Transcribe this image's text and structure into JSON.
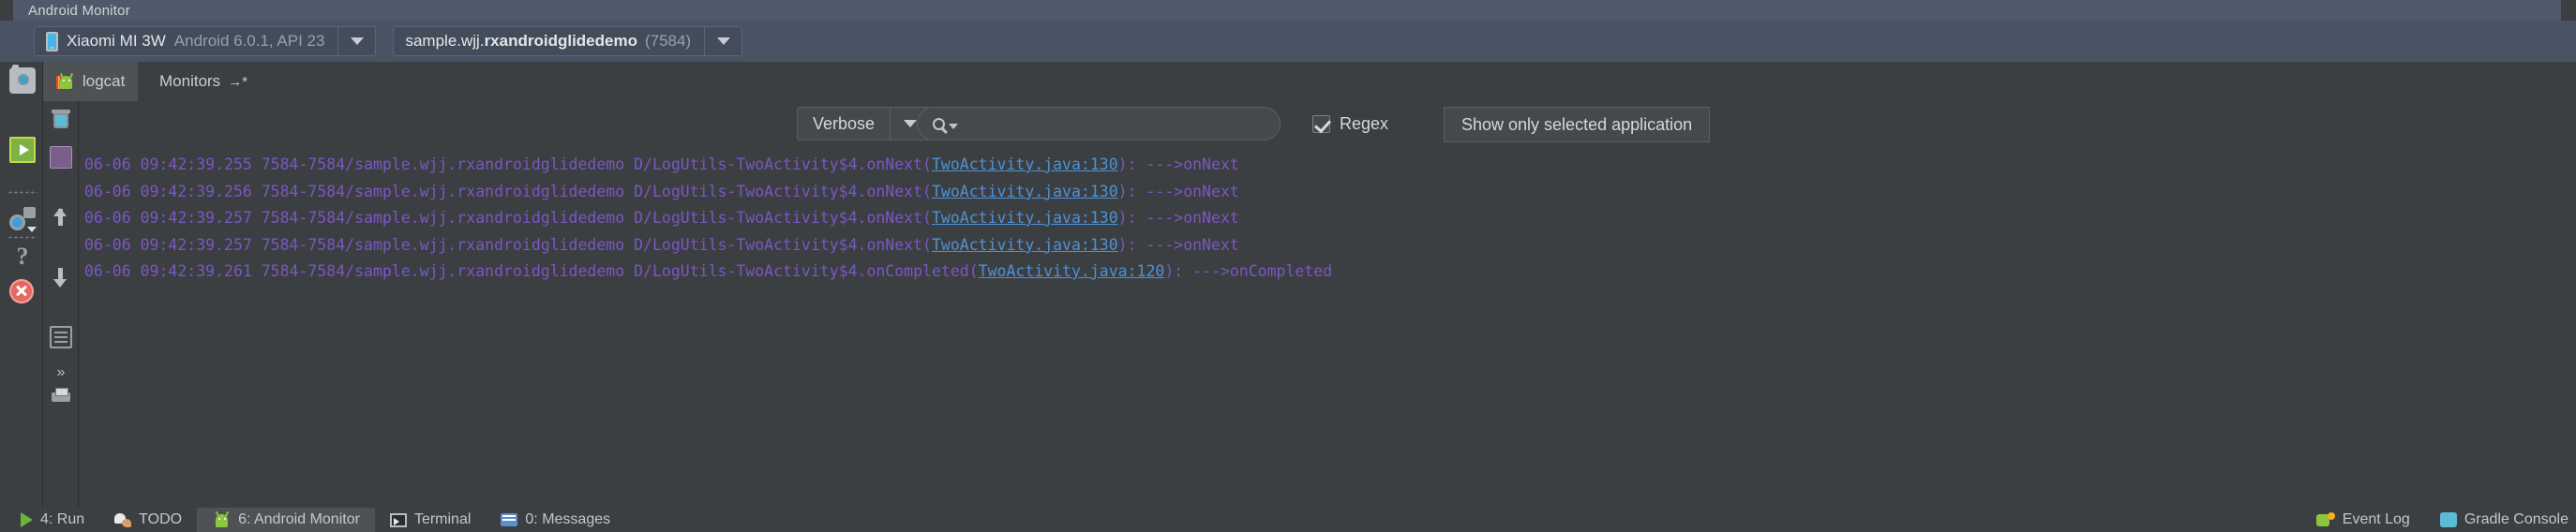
{
  "window": {
    "title": "Android Monitor"
  },
  "toolbar": {
    "device": {
      "icon": "phone-icon",
      "name": "Xiaomi MI 3W",
      "details": "Android 6.0.1, API 23",
      "dropdown_icon": "chevron-down-icon"
    },
    "process": {
      "package_prefix": "sample.wjj.",
      "package_name": "rxandroidglidedemo",
      "pid": "(7584)",
      "dropdown_icon": "chevron-down-icon"
    }
  },
  "left_toolstrip": {
    "icons": [
      {
        "name": "screenshot-camera-icon",
        "title": "Screen Capture"
      },
      {
        "name": "screen-record-play-icon",
        "title": "Screen Record"
      },
      {
        "name": "layout-inspector-icon",
        "title": "Layout Inspector"
      },
      {
        "name": "terminate-application-icon",
        "title": "Terminate Application"
      },
      {
        "name": "help-question-icon",
        "title": "Help"
      }
    ]
  },
  "tabs": [
    {
      "label": "logcat",
      "icon": "logcat-android-icon",
      "selected": true
    },
    {
      "label": "Monitors",
      "suffix": "→*",
      "icon": "monitors-icon",
      "selected": false
    }
  ],
  "logcat_tools": {
    "icons": [
      {
        "name": "clear-logcat-trash-icon"
      },
      {
        "name": "scroll-to-end-icon"
      },
      {
        "name": "up-arrow-icon"
      },
      {
        "name": "down-arrow-icon"
      },
      {
        "name": "soft-wrap-icon"
      },
      {
        "name": "print-icon"
      },
      {
        "name": "expand-more-icon",
        "glyph": "»"
      }
    ]
  },
  "filter_bar": {
    "log_level": {
      "value": "Verbose",
      "dropdown_icon": "chevron-down-icon"
    },
    "search": {
      "value": "",
      "placeholder": "",
      "icon": "search-icon"
    },
    "regex": {
      "label": "Regex",
      "checked": true
    },
    "app_filter": {
      "value": "Show only selected application",
      "dropdown_icon": "chevron-down-icon"
    }
  },
  "log_lines": [
    {
      "pre": "06-06 09:42:39.255 7584-7584/sample.wjj.rxandroidglidedemo D/LogUtils-TwoActivity$4.onNext(",
      "link": "TwoActivity.java:130",
      "post": "): --->onNext"
    },
    {
      "pre": "06-06 09:42:39.256 7584-7584/sample.wjj.rxandroidglidedemo D/LogUtils-TwoActivity$4.onNext(",
      "link": "TwoActivity.java:130",
      "post": "): --->onNext"
    },
    {
      "pre": "06-06 09:42:39.257 7584-7584/sample.wjj.rxandroidglidedemo D/LogUtils-TwoActivity$4.onNext(",
      "link": "TwoActivity.java:130",
      "post": "): --->onNext"
    },
    {
      "pre": "06-06 09:42:39.257 7584-7584/sample.wjj.rxandroidglidedemo D/LogUtils-TwoActivity$4.onNext(",
      "link": "TwoActivity.java:130",
      "post": "): --->onNext"
    },
    {
      "pre": "06-06 09:42:39.261 7584-7584/sample.wjj.rxandroidglidedemo D/LogUtils-TwoActivity$4.onCompleted(",
      "link": "TwoActivity.java:120",
      "post": "): --->onCompleted"
    }
  ],
  "status_bar": {
    "left_items": [
      {
        "label": "4: Run",
        "icon": "run-play-icon",
        "selected": false
      },
      {
        "label": "TODO",
        "icon": "todo-icon",
        "selected": false
      },
      {
        "label": "6: Android Monitor",
        "icon": "android-monitor-icon",
        "selected": true
      },
      {
        "label": "Terminal",
        "icon": "terminal-icon",
        "selected": false
      },
      {
        "label": "0: Messages",
        "icon": "messages-icon",
        "selected": false
      }
    ],
    "right_items": [
      {
        "label": "Event Log",
        "icon": "event-log-icon"
      },
      {
        "label": "Gradle Console",
        "icon": "gradle-console-icon"
      }
    ]
  },
  "colors": {
    "window_bg": "#3c3f41",
    "titlebar": "#4e5a69",
    "toolbar": "#4a5364",
    "log_text": "#7a56c4",
    "log_link": "#4e91d6",
    "selected_tab": "#4e5254"
  }
}
